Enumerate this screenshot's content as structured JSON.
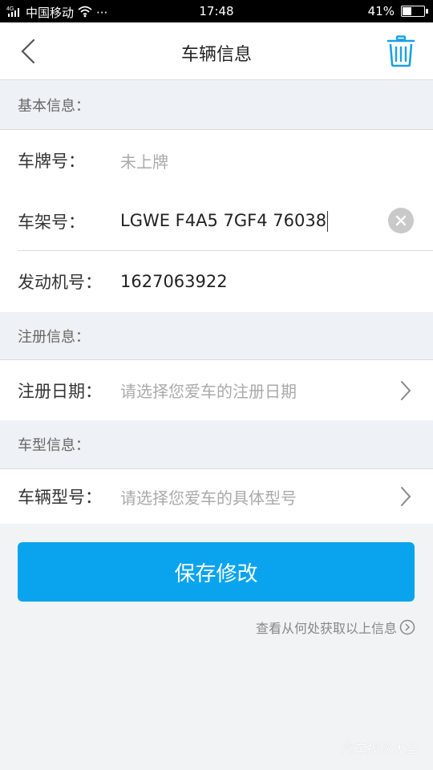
{
  "status_bar": {
    "carrier": "中国移动",
    "signal_prefix": "4G",
    "dots": "···",
    "time": "17:48",
    "battery_percent": "41%",
    "battery_level": 0.41
  },
  "header": {
    "title": "车辆信息"
  },
  "sections": {
    "basic": {
      "title": "基本信息：",
      "plate_label": "车牌号：",
      "plate_value": "未上牌",
      "vin_label": "车架号：",
      "vin_value": "LGWE F4A5 7GF4 76038",
      "engine_label": "发动机号：",
      "engine_value": "1627063922"
    },
    "registration": {
      "title": "注册信息：",
      "date_label": "注册日期：",
      "date_placeholder": "请选择您爱车的注册日期"
    },
    "model": {
      "title": "车型信息：",
      "model_label": "车辆型号：",
      "model_placeholder": "请选择您爱车的具体型号"
    }
  },
  "actions": {
    "save_label": "保存修改",
    "info_link": "查看从何处获取以上信息"
  },
  "watermark": "汽车报价大全",
  "colors": {
    "accent": "#0aa4ee",
    "section_bg": "#eef2f6",
    "page_bg": "#f2f3f5"
  }
}
